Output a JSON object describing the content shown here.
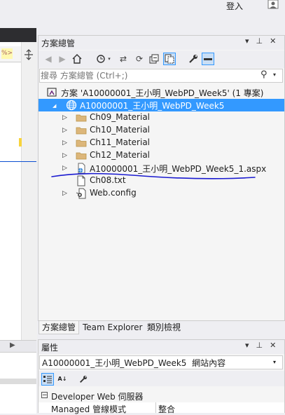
{
  "top": {
    "login_label": "登入"
  },
  "left_editor": {
    "snippet_glyph": "%>"
  },
  "solution_explorer": {
    "title": "方案總管",
    "title_controls": [
      "▾",
      "⊥",
      "✕"
    ],
    "search_placeholder": "搜尋 方案總管 (Ctrl+;)",
    "tree": [
      {
        "label": "方案 'A10000001_王小明_WebPD_Week5' (1 專案)",
        "icon": "solution-icon",
        "depth": 0,
        "expander": ""
      },
      {
        "label": "A10000001_王小明_WebPD_Week5",
        "icon": "globe-icon",
        "depth": 1,
        "expander": "◢",
        "selected": true
      },
      {
        "label": "Ch09_Material",
        "icon": "folder-icon",
        "depth": 2,
        "expander": "▷"
      },
      {
        "label": "Ch10_Material",
        "icon": "folder-icon",
        "depth": 2,
        "expander": "▷"
      },
      {
        "label": "Ch11_Material",
        "icon": "folder-icon",
        "depth": 2,
        "expander": "▷"
      },
      {
        "label": "Ch12_Material",
        "icon": "folder-icon",
        "depth": 2,
        "expander": "▷"
      },
      {
        "label": "A10000001_王小明_WebPD_Week5_1.aspx",
        "icon": "aspx-file-icon",
        "depth": 2,
        "expander": "▷"
      },
      {
        "label": "Ch08.txt",
        "icon": "text-file-icon",
        "depth": 2,
        "expander": ""
      },
      {
        "label": "Web.config",
        "icon": "config-file-icon",
        "depth": 2,
        "expander": "▷"
      }
    ],
    "tabs": [
      "方案總管",
      "Team Explorer",
      "類別檢視"
    ],
    "active_tab": "方案總管"
  },
  "properties": {
    "title": "屬性",
    "title_controls": [
      "▾",
      "⊥",
      "✕"
    ],
    "selected_object": "A10000001_王小明_WebPD_Week5  網站內容",
    "category": "Developer Web 伺服器",
    "rows": [
      {
        "name": "Managed 管線模式",
        "value": "整合"
      }
    ]
  },
  "colors": {
    "selection": "#3399ff",
    "annotation_ink": "#1a1ad0",
    "panel_bg": "#f5f5f5"
  }
}
